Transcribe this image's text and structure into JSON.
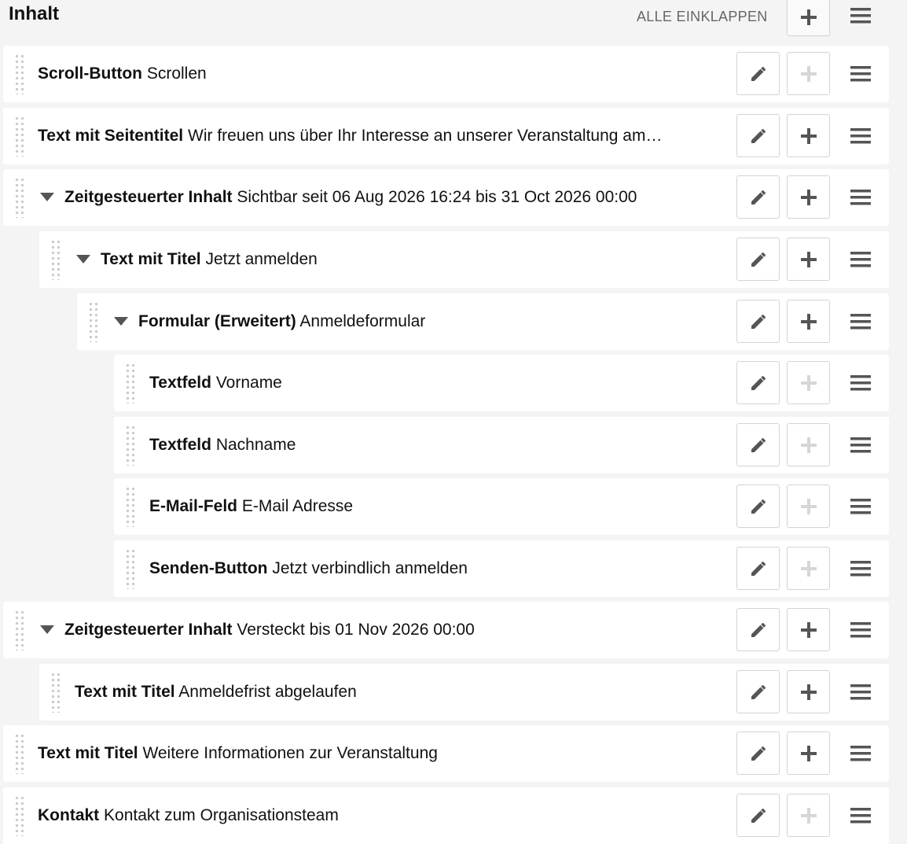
{
  "header": {
    "title": "Inhalt",
    "collapse_all_label": "ALLE EINKLAPPEN"
  },
  "icons": {
    "edit": "pencil-icon",
    "add": "plus-icon",
    "menu": "hamburger-menu-icon",
    "drag": "drag-handle-icon",
    "expand": "caret-down-icon"
  },
  "colors": {
    "icon": "#555555",
    "icon_disabled": "#d6d6d6",
    "row_bg": "#ffffff",
    "page_bg": "#f4f4f4"
  },
  "items": [
    {
      "type": "Scroll-Button",
      "summary": "Scrollen",
      "level": 0,
      "collapsible": false,
      "add_enabled": false
    },
    {
      "type": "Text mit Seitentitel",
      "summary": "Wir freuen uns über Ihr Interesse an unserer Veranstaltung am…",
      "level": 0,
      "collapsible": false,
      "add_enabled": true
    },
    {
      "type": "Zeitgesteuerter Inhalt",
      "summary": "Sichtbar seit 06 Aug 2026 16:24 bis 31 Oct 2026 00:00",
      "level": 0,
      "collapsible": true,
      "add_enabled": true
    },
    {
      "type": "Text mit Titel",
      "summary": "Jetzt anmelden",
      "level": 1,
      "collapsible": true,
      "add_enabled": true
    },
    {
      "type": "Formular (Erweitert)",
      "summary": "Anmeldeformular",
      "level": 2,
      "collapsible": true,
      "add_enabled": true
    },
    {
      "type": "Textfeld",
      "summary": "Vorname",
      "level": 3,
      "collapsible": false,
      "add_enabled": false
    },
    {
      "type": "Textfeld",
      "summary": "Nachname",
      "level": 3,
      "collapsible": false,
      "add_enabled": false
    },
    {
      "type": "E-Mail-Feld",
      "summary": "E-Mail Adresse",
      "level": 3,
      "collapsible": false,
      "add_enabled": false
    },
    {
      "type": "Senden-Button",
      "summary": "Jetzt verbindlich anmelden",
      "level": 3,
      "collapsible": false,
      "add_enabled": false
    },
    {
      "type": "Zeitgesteuerter Inhalt",
      "summary": "Versteckt bis 01 Nov 2026 00:00",
      "level": 0,
      "collapsible": true,
      "add_enabled": true
    },
    {
      "type": "Text mit Titel",
      "summary": "Anmeldefrist abgelaufen",
      "level": 1,
      "collapsible": false,
      "add_enabled": true
    },
    {
      "type": "Text mit Titel",
      "summary": "Weitere Informationen zur Veranstaltung",
      "level": 0,
      "collapsible": false,
      "add_enabled": true
    },
    {
      "type": "Kontakt",
      "summary": "Kontakt zum Organisationsteam",
      "level": 0,
      "collapsible": false,
      "add_enabled": false
    }
  ]
}
